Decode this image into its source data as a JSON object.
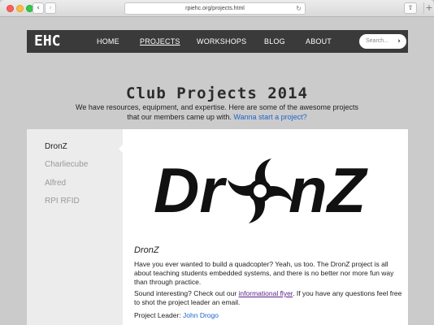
{
  "browser": {
    "url": "rpiehc.org/projects.html",
    "back_icon": "chevron-left-icon",
    "forward_icon": "chevron-right-icon",
    "reload_icon": "reload-icon",
    "share_icon": "share-icon",
    "new_tab_icon": "plus-icon"
  },
  "site_nav": {
    "logo": "EHC",
    "links": [
      {
        "label": "HOME",
        "active": false
      },
      {
        "label": "PROJECTS",
        "active": true
      },
      {
        "label": "WORKSHOPS",
        "active": false
      },
      {
        "label": "BLOG",
        "active": false
      },
      {
        "label": "ABOUT",
        "active": false
      }
    ],
    "search_placeholder": "Search..."
  },
  "heading": {
    "title": "Club Projects 2014",
    "intro_line1": "We have resources, equipment, and expertise. Here are some of the awesome projects",
    "intro_line2": "that our members came up with.",
    "intro_link": "Wanna start a project?"
  },
  "sidebar": {
    "items": [
      {
        "label": "DronZ",
        "active": true
      },
      {
        "label": "Charliecube",
        "active": false
      },
      {
        "label": "Alfred",
        "active": false
      },
      {
        "label": "RPI RFID",
        "active": false
      }
    ]
  },
  "project": {
    "logo_text_left": "Dr",
    "logo_text_right": "nZ",
    "name": "DronZ",
    "paragraph1": "Have you ever wanted to build a quadcopter? Yeah, us too. The DronZ project is all about teaching students embedded systems, and there is no better nor more fun way than through practice.",
    "paragraph2_before": "Sound interesting? Check out our",
    "paragraph2_link": "informational flyer",
    "paragraph2_after": ". If you have any questions feel free to shot the project leader an email.",
    "leader_label": "Project Leader:",
    "leader_name": "John Drogo"
  },
  "colors": {
    "nav_bg": "#3a3a3a",
    "link_blue": "#1f63c9",
    "visited_purple": "#5a1f8a",
    "page_bg": "#cbcbcb"
  }
}
